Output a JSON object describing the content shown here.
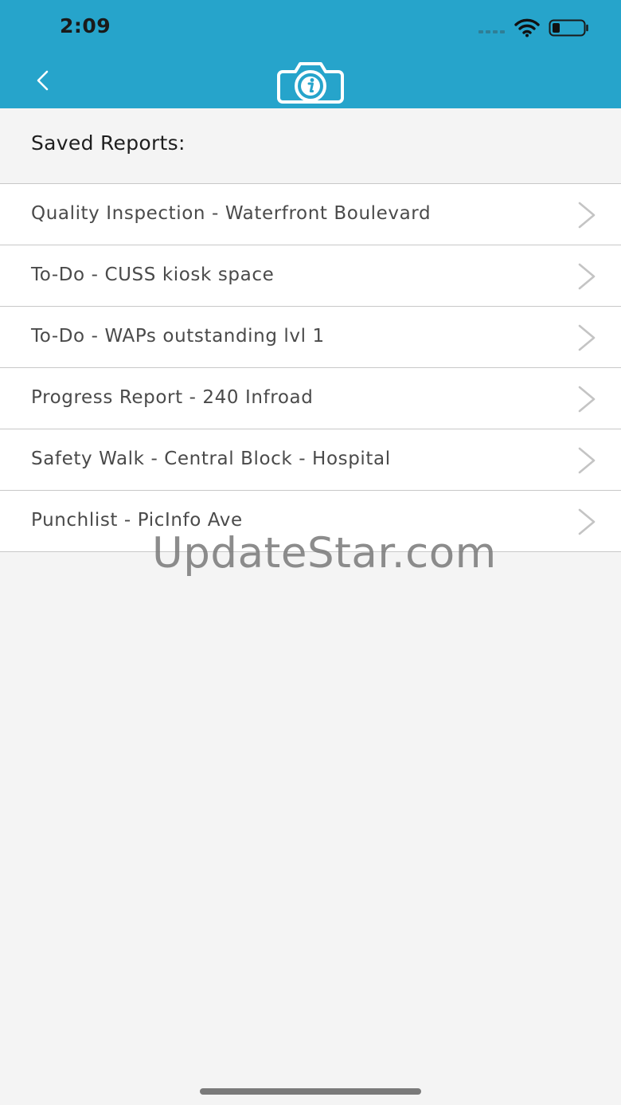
{
  "status_bar": {
    "time": "2:09",
    "icons": [
      "cellular-signal-icon",
      "wifi-icon",
      "battery-icon"
    ]
  },
  "nav": {
    "back_icon": "chevron-left-icon",
    "logo_icon": "camera-info-icon"
  },
  "section_title": "Saved Reports:",
  "reports": [
    {
      "label": "Quality Inspection - Waterfront Boulevard"
    },
    {
      "label": "To-Do - CUSS kiosk space"
    },
    {
      "label": "To-Do - WAPs outstanding lvl 1"
    },
    {
      "label": "Progress Report - 240 Infroad"
    },
    {
      "label": "Safety Walk - Central Block - Hospital"
    },
    {
      "label": "Punchlist - PicInfo Ave"
    }
  ],
  "watermark": "UpdateStar.com",
  "colors": {
    "header": "#26a4cb",
    "background": "#f4f4f4",
    "row": "#ffffff",
    "divider": "#c8c8c8"
  }
}
